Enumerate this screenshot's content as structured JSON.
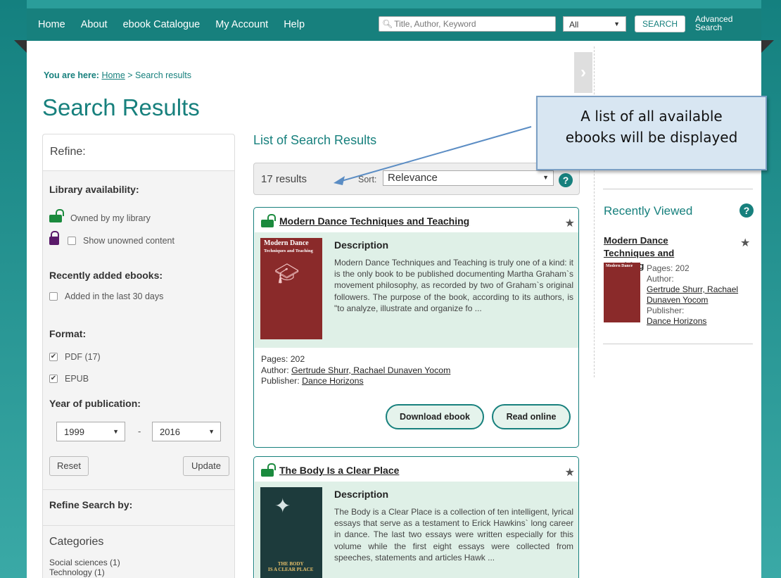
{
  "nav": {
    "links": [
      "Home",
      "About",
      "ebook Catalogue",
      "My Account",
      "Help"
    ],
    "search_placeholder": "Title, Author, Keyword",
    "search_scope": "All",
    "search_button": "SEARCH",
    "advanced_line1": "Advanced",
    "advanced_line2": "Search"
  },
  "breadcrumb": {
    "prefix": "You are here:",
    "home": "Home",
    "separator": " > ",
    "current": "Search results"
  },
  "page_title": "Search Results",
  "sidebar": {
    "refine_label": "Refine:",
    "availability_title": "Library availability:",
    "owned_label": "Owned by my library",
    "unowned_label": "Show unowned content",
    "recent_title": "Recently added ebooks:",
    "recent_label": "Added in the last 30 days",
    "format_title": "Format:",
    "formats": [
      "PDF (17)",
      "EPUB"
    ],
    "year_title": "Year of publication:",
    "year_from": "1999",
    "year_to": "2016",
    "year_dash": "-",
    "reset_label": "Reset",
    "update_label": "Update",
    "refine_by_title": "Refine Search by:",
    "categories_title": "Categories",
    "categories": [
      "Social sciences (1)",
      "Technology (1)"
    ]
  },
  "results": {
    "list_title": "List of Search Results",
    "count": "17 results",
    "sort_label": "Sort:",
    "sort_value": "Relevance"
  },
  "books": [
    {
      "title": "Modern Dance Techniques and Teaching",
      "cover_text": "Modern Dance\nTechniques and Teaching",
      "desc_heading": "Description",
      "description": "Modern Dance Techniques and Teaching is truly one of a kind: it is the only book to be published documenting Martha Graham`s movement philosophy, as recorded by two of Graham`s original followers. The purpose of the book, according to its authors, is \"to analyze, illustrate and organize fo ...",
      "pages": "Pages: 202",
      "author_label": "Author:",
      "author": "Gertrude Shurr, Rachael Dunaven Yocom",
      "publisher_label": "Publisher:",
      "publisher": "Dance Horizons",
      "download_label": "Download ebook",
      "read_label": "Read online"
    },
    {
      "title": "The Body Is a Clear Place",
      "cover_text": "THE BODY\nIS A CLEAR PLACE",
      "desc_heading": "Description",
      "description": "The Body is a Clear Place is a collection of ten intelligent, lyrical essays that serve as a testament to Erick Hawkins` long career in dance. The last two essays were written especially for this volume while the first eight essays were collected from speeches, statements and articles Hawk ..."
    }
  ],
  "recently_viewed": {
    "title": "Recently Viewed",
    "book_title": "Modern Dance Techniques and Teaching",
    "pages": "Pages: 202",
    "author_label": "Author:",
    "author": "Gertrude Shurr, Rachael Dunaven Yocom",
    "publisher_label": "Publisher:",
    "publisher": "Dance Horizons"
  },
  "callout": {
    "line1": "A list of all available",
    "line2": "ebooks will be displayed"
  },
  "colors": {
    "brand": "#17807d",
    "owned_lock": "#1a8a3d",
    "unowned_lock": "#5a1a6a",
    "card_bg": "#dff0e7"
  }
}
